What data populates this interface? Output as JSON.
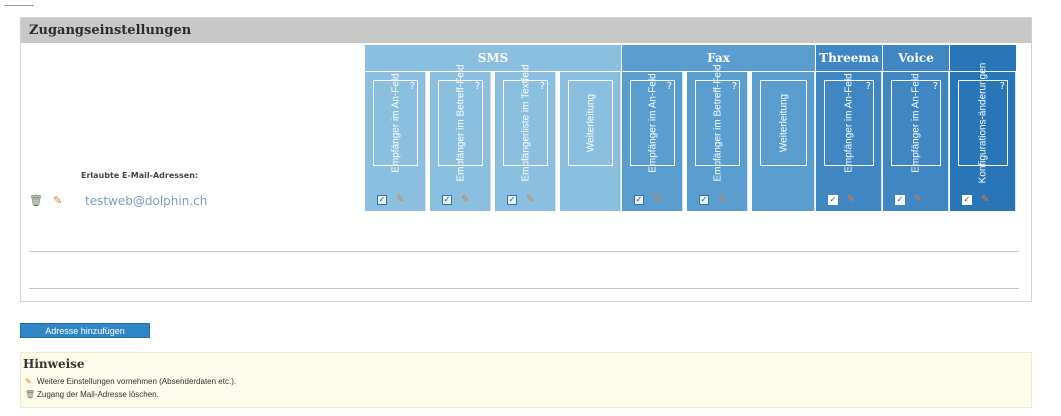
{
  "panel": {
    "title": "Zugangseinstellungen",
    "emails_label": "Erlaubte E-Mail-Adressen:"
  },
  "groups": [
    {
      "label": "SMS",
      "color": "#8bbfe0"
    },
    {
      "label": "Fax",
      "color": "#5a9ed0"
    },
    {
      "label": "Threema",
      "color": "#3f86c3"
    },
    {
      "label": "Voice",
      "color": "#3f86c3"
    },
    {
      "label": "",
      "color": "#2876b8"
    }
  ],
  "columns": [
    {
      "label": "Empfänger im An-Feld",
      "has_help": true,
      "checked": true,
      "editable": true
    },
    {
      "label": "Empfänger im Betreff-Feld",
      "has_help": true,
      "checked": true,
      "editable": true
    },
    {
      "label": "Empfängerliste im Textfeld",
      "has_help": true,
      "checked": true,
      "editable": true
    },
    {
      "label": "Weiterleitung",
      "has_help": false,
      "checked": false,
      "editable": false
    },
    {
      "label": "Empfänger im An-Feld",
      "has_help": true,
      "checked": true,
      "editable": true
    },
    {
      "label": "Empfänger im Betreff-Feld",
      "has_help": true,
      "checked": true,
      "editable": true
    },
    {
      "label": "Weiterleitung",
      "has_help": false,
      "checked": false,
      "editable": false
    },
    {
      "label": "Empfänger im An-Feld",
      "has_help": true,
      "checked": true,
      "editable": true
    },
    {
      "label": "Empfänger im An-Feld",
      "has_help": true,
      "checked": true,
      "editable": true
    },
    {
      "label": "Konfigurations-änderungen",
      "has_help": true,
      "checked": true,
      "editable": true
    }
  ],
  "help_glyph": "?",
  "rows": [
    {
      "email": "testweb@dolphin.ch"
    }
  ],
  "add_button": "Adresse hinzufügen",
  "notes": {
    "title": "Hinweise",
    "items": [
      {
        "icon": "pencil-icon",
        "text": "Weitere Einstellungen vornehmen (Absenderdaten etc.)."
      },
      {
        "icon": "trash-icon",
        "text": "Zugang der Mail-Adresse löschen."
      }
    ]
  }
}
